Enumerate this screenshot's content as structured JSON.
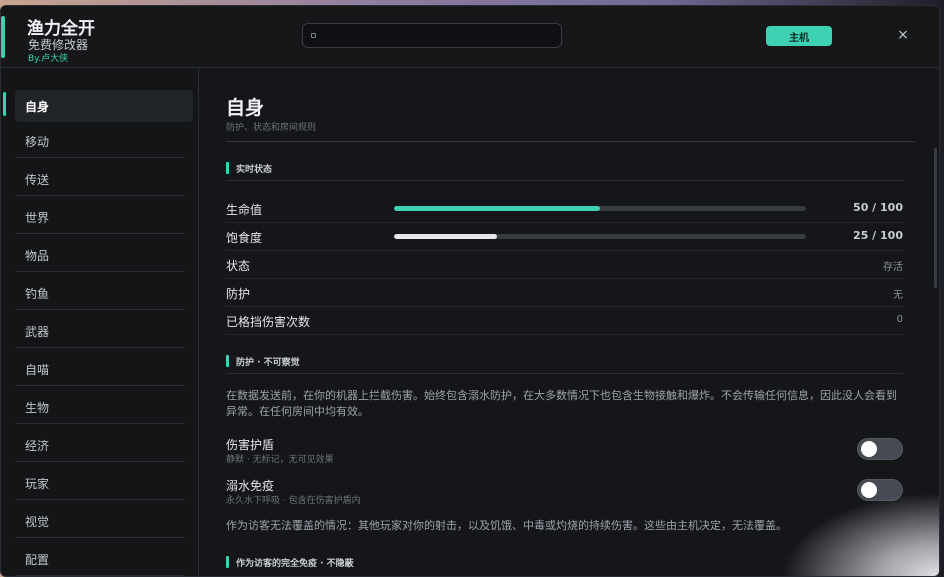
{
  "app": {
    "title": "渔力全开",
    "subtitle": "免费修改器",
    "credit": "By.卢大侠"
  },
  "search": {
    "placeholder": ""
  },
  "header": {
    "host_label": "主机",
    "close_label": "×"
  },
  "sidebar": {
    "items": [
      {
        "label": "自身"
      },
      {
        "label": "移动"
      },
      {
        "label": "传送"
      },
      {
        "label": "世界"
      },
      {
        "label": "物品"
      },
      {
        "label": "钓鱼"
      },
      {
        "label": "武器"
      },
      {
        "label": "自喵"
      },
      {
        "label": "生物"
      },
      {
        "label": "经济"
      },
      {
        "label": "玩家"
      },
      {
        "label": "视觉"
      },
      {
        "label": "配置"
      }
    ],
    "active_index": 0
  },
  "page": {
    "title": "自身",
    "subtitle": "防护、状态和房间规则"
  },
  "status_section": {
    "title": "实时状态",
    "rows": [
      {
        "label": "生命值",
        "value": "50 / 100",
        "fraction": 0.5,
        "color": "#3fd1b3"
      },
      {
        "label": "饱食度",
        "value": "25 / 100",
        "fraction": 0.25,
        "color": "#e6e8ee"
      },
      {
        "label": "状态",
        "value": "存活"
      },
      {
        "label": "防护",
        "value": "无"
      },
      {
        "label": "已格挡伤害次数",
        "value": "0"
      }
    ]
  },
  "protection_section": {
    "title": "防护 · 不可察觉",
    "description": "在数据发送前，在你的机器上拦截伤害。始终包含溺水防护，在大多数情况下也包含生物接触和爆炸。不会传输任何信息，因此没人会看到异常。在任何房间中均有效。",
    "toggles": [
      {
        "label": "伤害护盾",
        "sub": "静默 · 无标记，无可见效果",
        "on": false
      },
      {
        "label": "溺水免疫",
        "sub": "永久水下呼吸 · 包含在伤害护盾内",
        "on": false
      }
    ],
    "note": "作为访客无法覆盖的情况：其他玩家对你的射击，以及饥饿、中毒或灼烧的持续伤害。这些由主机决定，无法覆盖。"
  },
  "guest_section": {
    "title": "作为访客的完全免疫 · 不隐蔽"
  },
  "colors": {
    "accent": "#3fd1b3",
    "background": "#141619"
  }
}
